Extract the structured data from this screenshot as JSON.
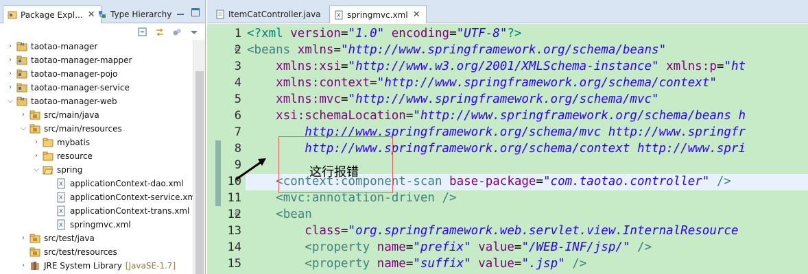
{
  "left_panel": {
    "tabs": [
      {
        "label": "Package Expl...",
        "close": "✕",
        "active": true
      },
      {
        "label": "Type Hierarchy",
        "close": "",
        "active": false
      }
    ],
    "tree": [
      {
        "label": "taotao-manager",
        "suffix": ""
      },
      {
        "label": "taotao-manager-mapper",
        "suffix": ""
      },
      {
        "label": "taotao-manager-pojo",
        "suffix": ""
      },
      {
        "label": "taotao-manager-service",
        "suffix": ""
      },
      {
        "label": "taotao-manager-web",
        "suffix": ""
      },
      {
        "label": "src/main/java",
        "suffix": ""
      },
      {
        "label": "src/main/resources",
        "suffix": ""
      },
      {
        "label": "mybatis",
        "suffix": ""
      },
      {
        "label": "resource",
        "suffix": ""
      },
      {
        "label": "spring",
        "suffix": ""
      },
      {
        "label": "applicationContext-dao.xml",
        "suffix": ""
      },
      {
        "label": "applicationContext-service.xml",
        "suffix": ""
      },
      {
        "label": "applicationContext-trans.xml",
        "suffix": ""
      },
      {
        "label": "springmvc.xml",
        "suffix": ""
      },
      {
        "label": "src/test/java",
        "suffix": ""
      },
      {
        "label": "src/test/resources",
        "suffix": ""
      },
      {
        "label": "JRE System Library",
        "suffix": "[JavaSE-1.7]"
      }
    ]
  },
  "editor": {
    "tabs": [
      {
        "label": "ItemCatController.java",
        "active": false
      },
      {
        "label": "springmvc.xml",
        "close": "✕",
        "active": true
      }
    ],
    "line_numbers": [
      "1",
      "2",
      "3",
      "4",
      "5",
      "6",
      "7",
      "8",
      "9",
      "10",
      "11",
      "12",
      "13",
      "14",
      "15"
    ],
    "lines": [
      [
        [
          "pi",
          "<?xml "
        ],
        [
          "attr",
          "version"
        ],
        [
          "txt",
          "="
        ],
        [
          "val",
          "\"1.0\""
        ],
        [
          "txt",
          " "
        ],
        [
          "attr",
          "encoding"
        ],
        [
          "txt",
          "="
        ],
        [
          "val",
          "\"UTF-8\""
        ],
        [
          "pi",
          "?>"
        ]
      ],
      [
        [
          "tag",
          "<beans "
        ],
        [
          "attr",
          "xmlns"
        ],
        [
          "txt",
          "="
        ],
        [
          "val",
          "\"http://www.springframework.org/schema/beans\""
        ]
      ],
      [
        [
          "txt",
          "    "
        ],
        [
          "attr",
          "xmlns:xsi"
        ],
        [
          "txt",
          "="
        ],
        [
          "val",
          "\"http://www.w3.org/2001/XMLSchema-instance\""
        ],
        [
          "txt",
          " "
        ],
        [
          "attr",
          "xmlns:p"
        ],
        [
          "txt",
          "="
        ],
        [
          "val",
          "\"ht"
        ]
      ],
      [
        [
          "txt",
          "    "
        ],
        [
          "attr",
          "xmlns:context"
        ],
        [
          "txt",
          "="
        ],
        [
          "val",
          "\"http://www.springframework.org/schema/context\""
        ]
      ],
      [
        [
          "txt",
          "    "
        ],
        [
          "attr",
          "xmlns:mvc"
        ],
        [
          "txt",
          "="
        ],
        [
          "val",
          "\"http://www.springframework.org/schema/mvc\""
        ]
      ],
      [
        [
          "txt",
          "    "
        ],
        [
          "attr",
          "xsi:schemaLocation"
        ],
        [
          "txt",
          "="
        ],
        [
          "val",
          "\"http://www.springframework.org/schema/beans h"
        ]
      ],
      [
        [
          "txt",
          "        "
        ],
        [
          "val",
          "http://www.springframework.org/schema/mvc http://www.springfr"
        ]
      ],
      [
        [
          "txt",
          "        "
        ],
        [
          "val",
          "http://www.springframework.org/schema/context http://www.spri"
        ]
      ],
      [],
      [
        [
          "txt",
          "    "
        ],
        [
          "tag",
          "<context:component-scan "
        ],
        [
          "attr",
          "base-package"
        ],
        [
          "txt",
          "="
        ],
        [
          "val",
          "\"com.taotao.controller\""
        ],
        [
          "txt",
          " "
        ],
        [
          "tag",
          "/>"
        ]
      ],
      [
        [
          "txt",
          "    "
        ],
        [
          "tag",
          "<mvc:annotation-driven "
        ],
        [
          "tag",
          "/>"
        ]
      ],
      [
        [
          "txt",
          "    "
        ],
        [
          "tag",
          "<bean"
        ]
      ],
      [
        [
          "txt",
          "        "
        ],
        [
          "attr",
          "class"
        ],
        [
          "txt",
          "="
        ],
        [
          "val",
          "\"org.springframework.web.servlet.view.InternalResource"
        ]
      ],
      [
        [
          "txt",
          "        "
        ],
        [
          "tag",
          "<property "
        ],
        [
          "attr",
          "name"
        ],
        [
          "txt",
          "="
        ],
        [
          "val",
          "\"prefix\""
        ],
        [
          "txt",
          " "
        ],
        [
          "attr",
          "value"
        ],
        [
          "txt",
          "="
        ],
        [
          "val",
          "\"/WEB-INF/jsp/\""
        ],
        [
          "txt",
          " "
        ],
        [
          "tag",
          "/>"
        ]
      ],
      [
        [
          "txt",
          "        "
        ],
        [
          "tag",
          "<property "
        ],
        [
          "attr",
          "name"
        ],
        [
          "txt",
          "="
        ],
        [
          "val",
          "\"suffix\""
        ],
        [
          "txt",
          " "
        ],
        [
          "attr",
          "value"
        ],
        [
          "txt",
          "="
        ],
        [
          "val",
          "\".jsp\""
        ],
        [
          "txt",
          " "
        ],
        [
          "tag",
          "/>"
        ]
      ]
    ],
    "fold_markers": {
      "2": "⊖",
      "10": "",
      "12": "⊖"
    }
  },
  "annotation": {
    "text": "这行报错",
    "box_color": "#e55a5a"
  },
  "colors": {
    "editor_bg": "#c7ebc7",
    "current_line": "#e8f2fe",
    "tab_bg": "#dae5f3"
  }
}
